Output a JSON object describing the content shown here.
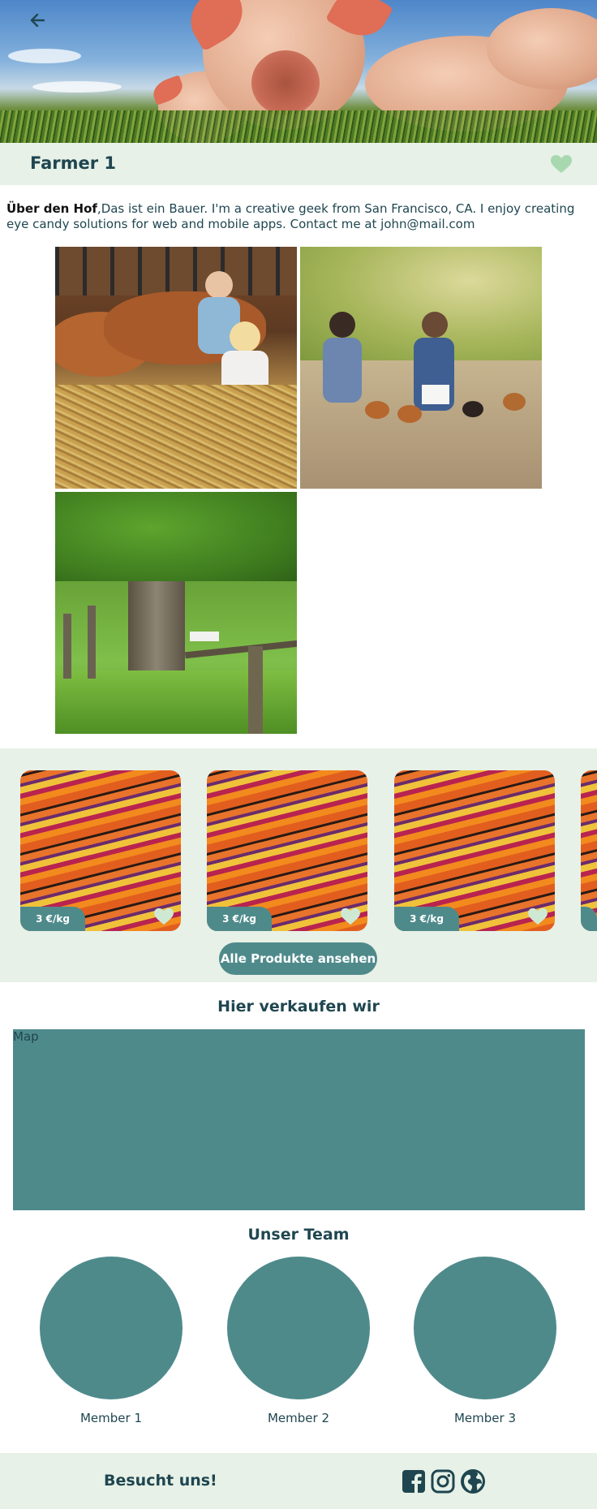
{
  "header": {
    "back_icon": "arrow-left-icon",
    "farm_name": "Farmer 1",
    "favorite_icon": "heart-icon"
  },
  "about": {
    "label": "Über den Hof",
    "text": ",Das ist ein Bauer. I'm a creative geek from San Francisco, CA. I enjoy creating eye candy solutions for web and mobile apps. Contact me at john@mail.com"
  },
  "gallery": {
    "images": [
      "cows-children-hay",
      "children-chickens",
      "tree-fence-meadow"
    ]
  },
  "products": {
    "items": [
      {
        "price": "3 €/kg",
        "image": "carrots"
      },
      {
        "price": "3 €/kg",
        "image": "carrots"
      },
      {
        "price": "3 €/kg",
        "image": "carrots"
      }
    ],
    "all_button": "Alle Produkte ansehen"
  },
  "map_section": {
    "title": "Hier verkaufen wir",
    "map_label": "Map"
  },
  "team": {
    "title": "Unser Team",
    "members": [
      "Member 1",
      "Member 2",
      "Member 3"
    ]
  },
  "footer": {
    "text": "Besucht uns!",
    "icons": [
      "facebook-icon",
      "instagram-icon",
      "globe-icon"
    ]
  },
  "colors": {
    "primary": "#4f8a8b",
    "text": "#1f4650",
    "light_bg": "#e7f1e7",
    "heart": "#a8d8b0"
  }
}
